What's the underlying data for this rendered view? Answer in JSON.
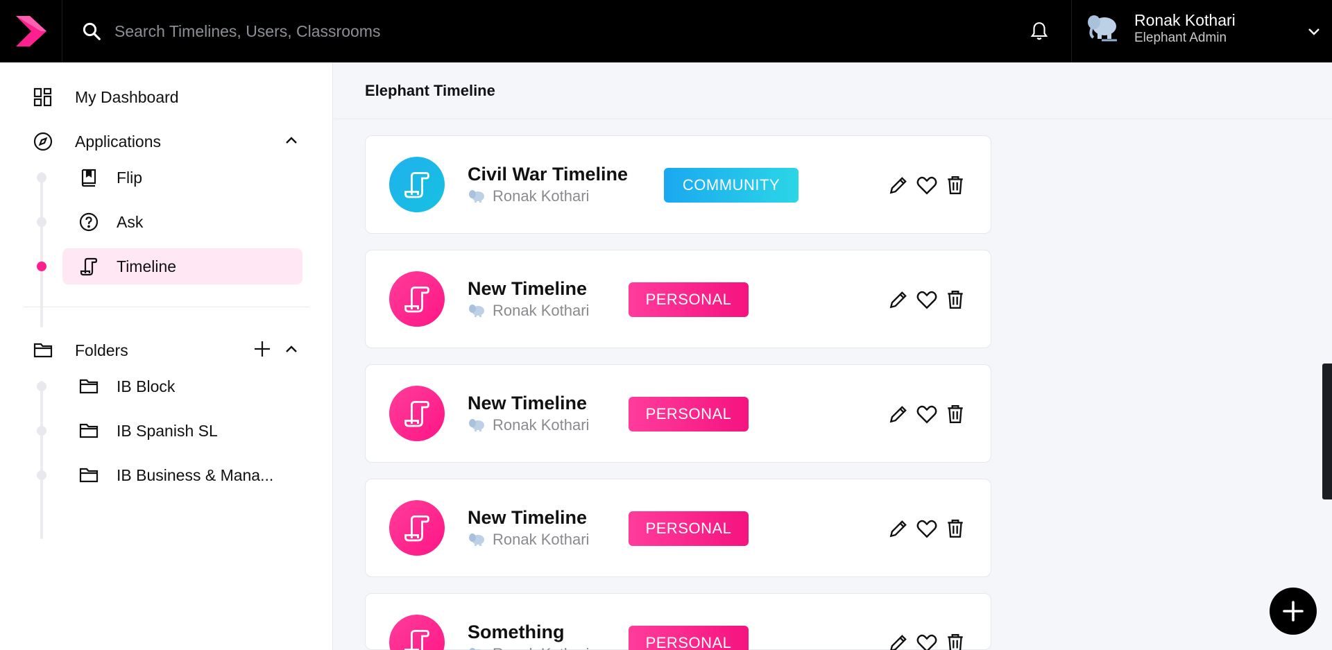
{
  "topbar": {
    "search_placeholder": "Search Timelines, Users, Classrooms",
    "user": {
      "name": "Ronak Kothari",
      "role": "Elephant Admin"
    }
  },
  "sidebar": {
    "dashboard_label": "My Dashboard",
    "applications_label": "Applications",
    "apps": [
      {
        "label": "Flip",
        "icon": "book-icon"
      },
      {
        "label": "Ask",
        "icon": "question-circle-icon"
      },
      {
        "label": "Timeline",
        "icon": "scroll-icon",
        "active": true
      }
    ],
    "folders_label": "Folders",
    "folders": [
      {
        "label": "IB Block"
      },
      {
        "label": "IB Spanish SL"
      },
      {
        "label": "IB Business & Mana..."
      }
    ]
  },
  "main": {
    "title": "Elephant Timeline",
    "timelines": [
      {
        "title": "Civil War Timeline",
        "owner": "Ronak Kothari",
        "badge": "COMMUNITY",
        "type": "community"
      },
      {
        "title": "New Timeline",
        "owner": "Ronak Kothari",
        "badge": "PERSONAL",
        "type": "personal"
      },
      {
        "title": "New Timeline",
        "owner": "Ronak Kothari",
        "badge": "PERSONAL",
        "type": "personal"
      },
      {
        "title": "New Timeline",
        "owner": "Ronak Kothari",
        "badge": "PERSONAL",
        "type": "personal"
      },
      {
        "title": "Something",
        "owner": "Ronak Kothari",
        "badge": "PERSONAL",
        "type": "personal"
      }
    ]
  },
  "colors": {
    "accent": "#ff1f8e",
    "community": "#1fb1ee",
    "topbar": "#000000"
  }
}
